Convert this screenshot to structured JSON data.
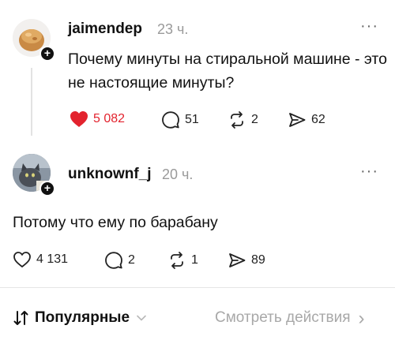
{
  "posts": [
    {
      "username": "jaimendep",
      "time": "23 ч.",
      "text": "Почему минуты на стиральной машине - это не настоящие минуты?",
      "more": "···",
      "likes": "5 082",
      "replies": "51",
      "reposts": "2",
      "shares": "62",
      "liked": true,
      "avatar_icon": "pastry-avatar"
    },
    {
      "username": "unknownf_j",
      "time": "20 ч.",
      "text": "Потому что ему по барабану",
      "more": "···",
      "likes": "4 131",
      "replies": "2",
      "reposts": "1",
      "shares": "89",
      "liked": false,
      "avatar_icon": "cat-avatar"
    }
  ],
  "footer": {
    "sort_label": "Популярные",
    "sort_icon": "sort-arrows-icon",
    "view_activity": "Смотреть действия",
    "view_arrow": "›"
  },
  "colors": {
    "like_red": "#e3232e",
    "muted": "#9a9a9a",
    "divider": "#e6e6e6"
  }
}
